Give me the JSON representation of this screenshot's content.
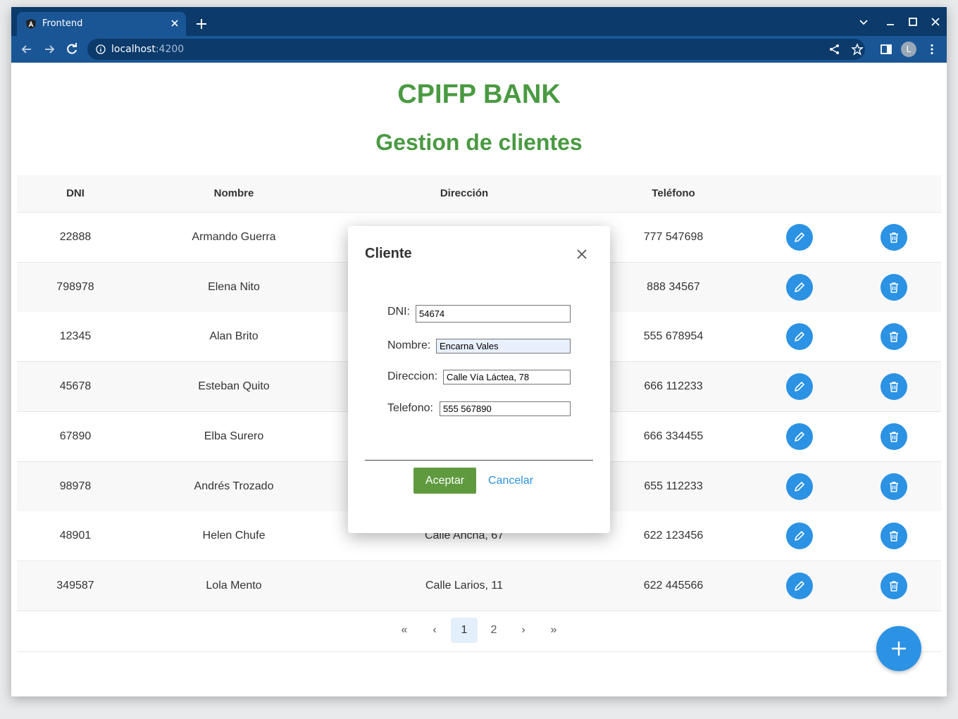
{
  "browser": {
    "tab_title": "Frontend",
    "url_host": "localhost",
    "url_port": ":4200",
    "profile_initial": "L"
  },
  "page": {
    "title": "CPIFP BANK",
    "subtitle": "Gestion de clientes"
  },
  "table": {
    "headers": [
      "DNI",
      "Nombre",
      "Dirección",
      "Teléfono"
    ],
    "rows": [
      {
        "dni": "22888",
        "nombre": "Armando Guerra",
        "direccion": "",
        "telefono": "777 547698"
      },
      {
        "dni": "798978",
        "nombre": "Elena Nito",
        "direccion": "",
        "telefono": "888 34567"
      },
      {
        "dni": "12345",
        "nombre": "Alan Brito",
        "direccion": "",
        "telefono": "555 678954"
      },
      {
        "dni": "45678",
        "nombre": "Esteban Quito",
        "direccion": "",
        "telefono": "666 112233"
      },
      {
        "dni": "67890",
        "nombre": "Elba Surero",
        "direccion": "",
        "telefono": "666 334455"
      },
      {
        "dni": "98978",
        "nombre": "Andrés Trozado",
        "direccion": "",
        "telefono": "655 112233"
      },
      {
        "dni": "48901",
        "nombre": "Helen Chufe",
        "direccion": "Calle Ancha, 67",
        "telefono": "622 123456"
      },
      {
        "dni": "349587",
        "nombre": "Lola Mento",
        "direccion": "Calle Larios, 11",
        "telefono": "622 445566"
      }
    ]
  },
  "pagination": {
    "first": "«",
    "prev": "‹",
    "pages": [
      "1",
      "2"
    ],
    "current": "1",
    "next": "›",
    "last": "»"
  },
  "modal": {
    "title": "Cliente",
    "fields": {
      "dni_label": "DNI:",
      "dni_value": "54674",
      "nombre_label": "Nombre:",
      "nombre_value": "Encarna Vales",
      "direccion_label": "Direccion:",
      "direccion_value": "Calle Vía Láctea, 78",
      "telefono_label": "Telefono:",
      "telefono_value": "555 567890"
    },
    "ok_label": "Aceptar",
    "cancel_label": "Cancelar"
  },
  "colors": {
    "accent_green": "#4a9a42",
    "button_blue": "#2b92e4",
    "ok_green": "#5f9a3f",
    "chrome_dark": "#0b3a6b",
    "chrome_tab": "#1a5696"
  }
}
